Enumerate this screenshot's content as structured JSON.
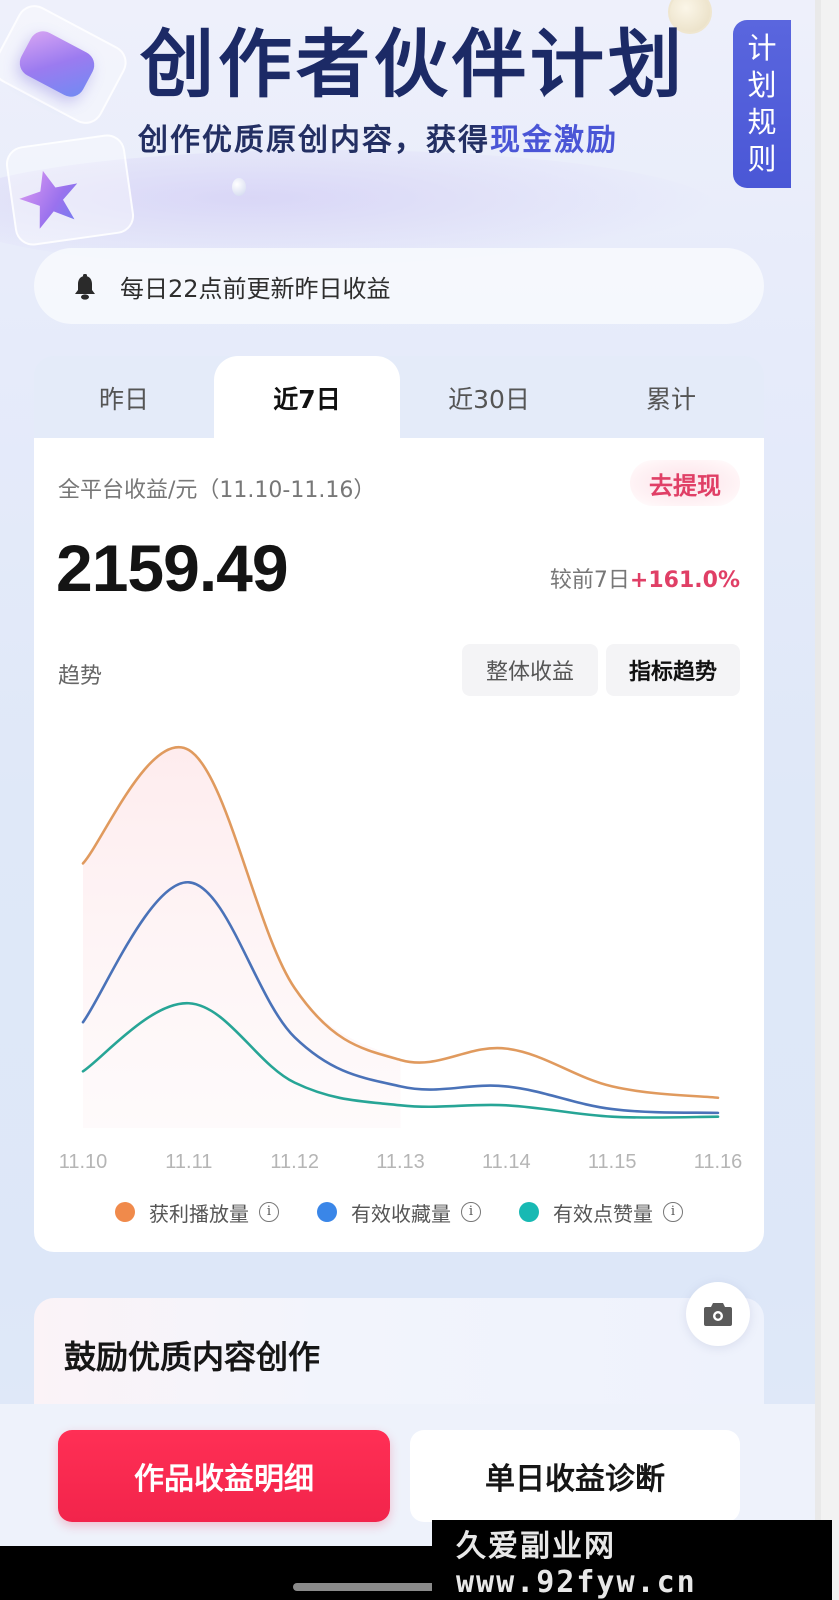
{
  "header": {
    "title": "创作者伙伴计划",
    "subtitle_prefix": "创作优质原创内容，获得",
    "subtitle_highlight": "现金激励",
    "rules_tab": [
      "计",
      "划",
      "规",
      "则"
    ]
  },
  "notice": {
    "icon": "bell-icon",
    "text": "每日22点前更新昨日收益"
  },
  "tabs": [
    {
      "label": "昨日",
      "active": false
    },
    {
      "label": "近7日",
      "active": true
    },
    {
      "label": "近30日",
      "active": false
    },
    {
      "label": "累计",
      "active": false
    }
  ],
  "income": {
    "label": "全平台收益/元（11.10-11.16）",
    "withdraw_label": "去提现",
    "total": "2159.49",
    "compare_label": "较前7日",
    "compare_delta": "+161.0%"
  },
  "trend": {
    "label": "趋势",
    "segments": [
      {
        "label": "整体收益",
        "active": false
      },
      {
        "label": "指标趋势",
        "active": true
      }
    ]
  },
  "chart_data": {
    "type": "line",
    "title": "",
    "xlabel": "",
    "ylabel": "",
    "x": [
      "11.10",
      "11.11",
      "11.12",
      "11.13",
      "11.14",
      "11.15",
      "11.16"
    ],
    "ylim": [
      0,
      100
    ],
    "y_unit": "relative (no y-axis labels shown)",
    "grid": false,
    "legend_position": "bottom",
    "series": [
      {
        "name": "获利播放量",
        "color": "#f08a4b",
        "line_color": "#e09a5e",
        "values": [
          70,
          100,
          37,
          18,
          21,
          11,
          8
        ]
      },
      {
        "name": "有效收藏量",
        "color": "#3a86e8",
        "line_color": "#4a72b8",
        "values": [
          28,
          65,
          24,
          11,
          11,
          5,
          4
        ]
      },
      {
        "name": "有效点赞量",
        "color": "#18b9b3",
        "line_color": "#27a596",
        "values": [
          15,
          33,
          12,
          6,
          6,
          3,
          3
        ]
      }
    ]
  },
  "section": {
    "title": "鼓励优质内容创作",
    "camera_icon": "camera-icon"
  },
  "actions": {
    "primary": "作品收益明细",
    "secondary": "单日收益诊断"
  },
  "watermark": "久爱副业网 www.92fyw.cn",
  "colors": {
    "brand_red": "#f2244b",
    "accent_pink": "#e03f66",
    "title_navy": "#1c2a66",
    "highlight_blue": "#4a55d6",
    "rules_tab_blue": "#5a66de"
  }
}
